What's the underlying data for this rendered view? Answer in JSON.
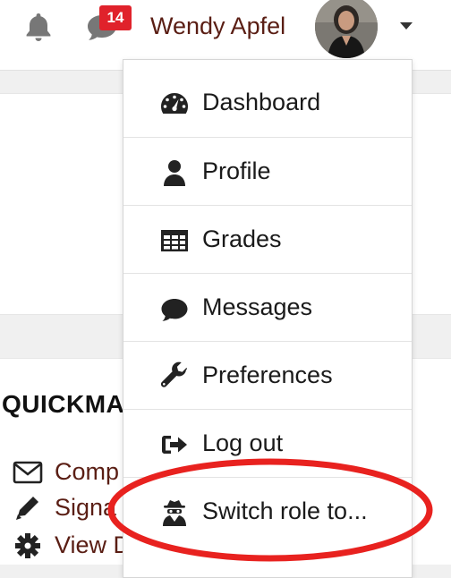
{
  "navbar": {
    "notification_icon": "bell-icon",
    "messages_icon": "comment-icon",
    "messages_badge": "14",
    "user_name": "Wendy Apfel",
    "menu_toggle_icon": "caret-down-icon"
  },
  "user_menu": {
    "items": [
      {
        "label": "Dashboard",
        "icon": "tachometer-icon"
      },
      {
        "label": "Profile",
        "icon": "user-icon"
      },
      {
        "label": "Grades",
        "icon": "table-icon"
      },
      {
        "label": "Messages",
        "icon": "comment-icon"
      },
      {
        "label": "Preferences",
        "icon": "wrench-icon"
      },
      {
        "label": "Log out",
        "icon": "sign-out-icon"
      },
      {
        "label": "Switch role to...",
        "icon": "user-secret-icon"
      }
    ],
    "highlight_color": "#e8221f"
  },
  "quickmail": {
    "title": "QUICKMA",
    "links": [
      {
        "label": "Comp",
        "icon": "envelope-icon"
      },
      {
        "label": "Signa",
        "icon": "pencil-icon"
      },
      {
        "label": "View D",
        "icon": "gear-icon"
      }
    ]
  },
  "colors": {
    "badge": "#e0222b",
    "user_name": "#5a1e14",
    "link": "#5a1e14"
  }
}
